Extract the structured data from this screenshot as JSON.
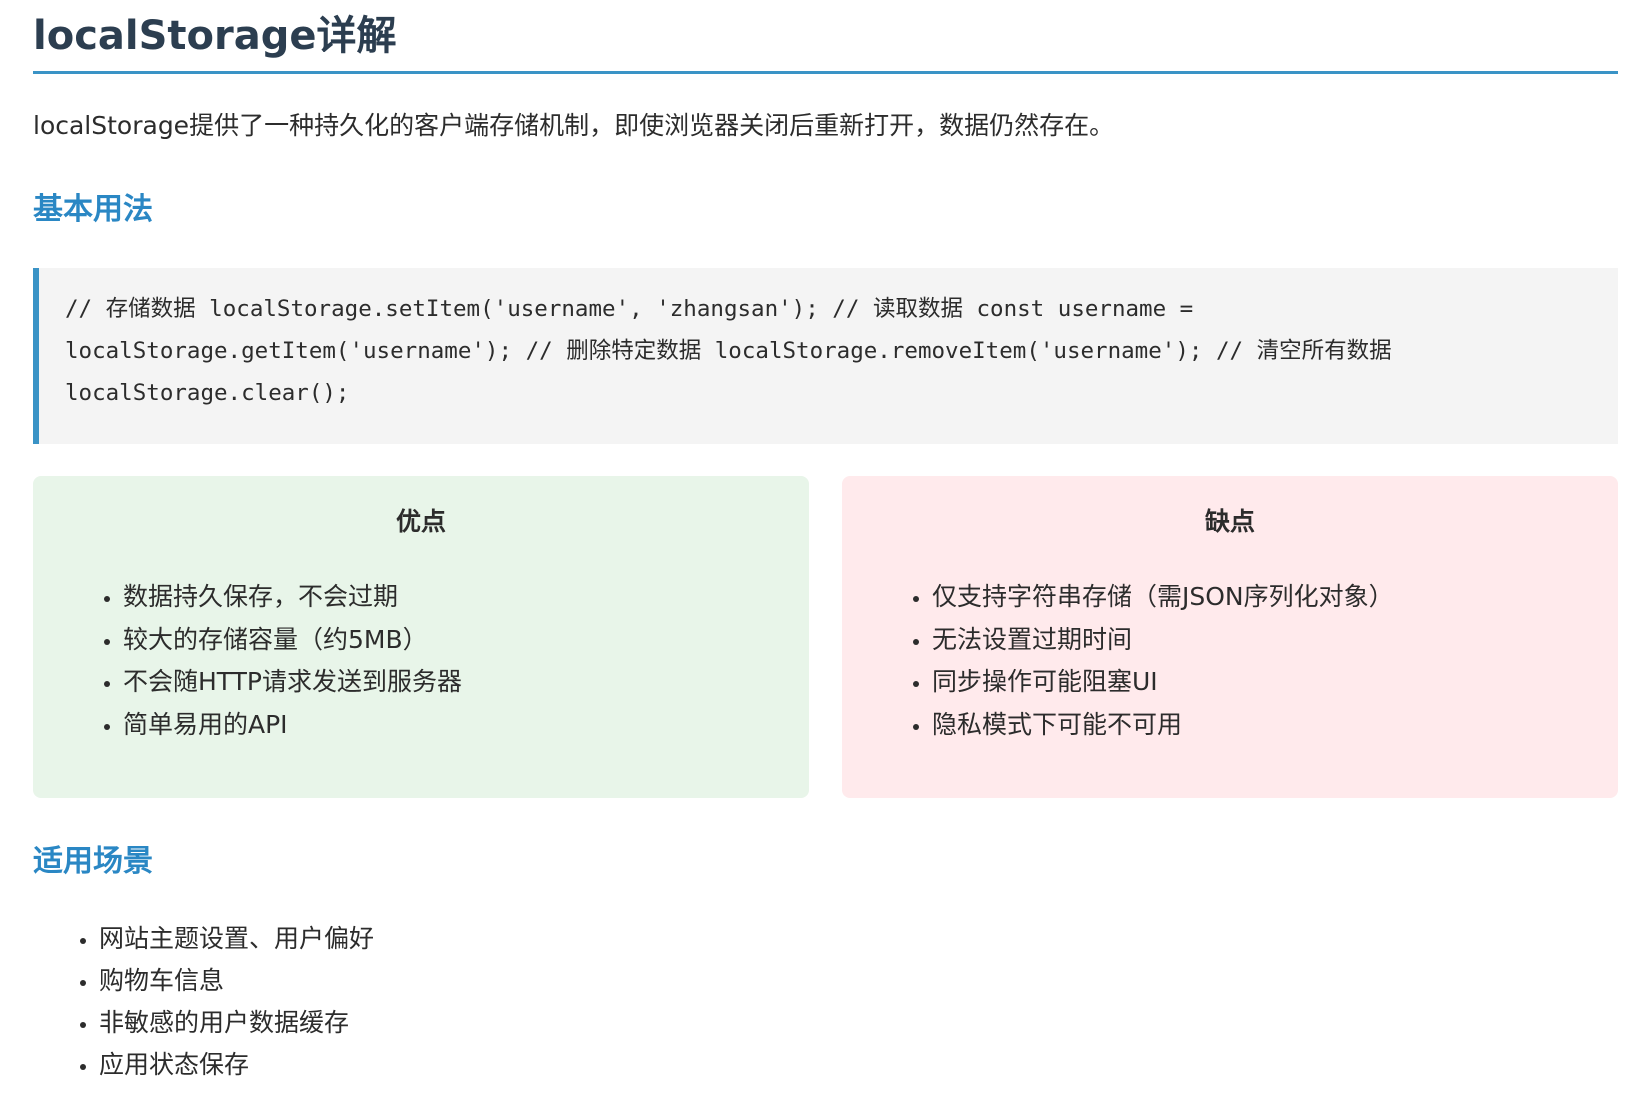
{
  "title": "localStorage详解",
  "intro": "localStorage提供了一种持久化的客户端存储机制，即使浏览器关闭后重新打开，数据仍然存在。",
  "basic_usage": {
    "heading": "基本用法",
    "code": "// 存储数据 localStorage.setItem('username', 'zhangsan'); // 读取数据 const username = localStorage.getItem('username'); // 删除特定数据 localStorage.removeItem('username'); // 清空所有数据 localStorage.clear();"
  },
  "pros": {
    "title": "优点",
    "items": [
      "数据持久保存，不会过期",
      "较大的存储容量（约5MB）",
      "不会随HTTP请求发送到服务器",
      "简单易用的API"
    ]
  },
  "cons": {
    "title": "缺点",
    "items": [
      "仅支持字符串存储（需JSON序列化对象）",
      "无法设置过期时间",
      "同步操作可能阻塞UI",
      "隐私模式下可能不可用"
    ]
  },
  "use_cases": {
    "heading": "适用场景",
    "items": [
      "网站主题设置、用户偏好",
      "购物车信息",
      "非敏感的用户数据缓存",
      "应用状态保存"
    ]
  },
  "colors": {
    "accent": "#3a93c6",
    "heading": "#2a87c4",
    "title": "#2c3e50",
    "pros_bg": "#e8f5e9",
    "cons_bg": "#ffeaec",
    "code_bg": "#f4f4f4"
  }
}
